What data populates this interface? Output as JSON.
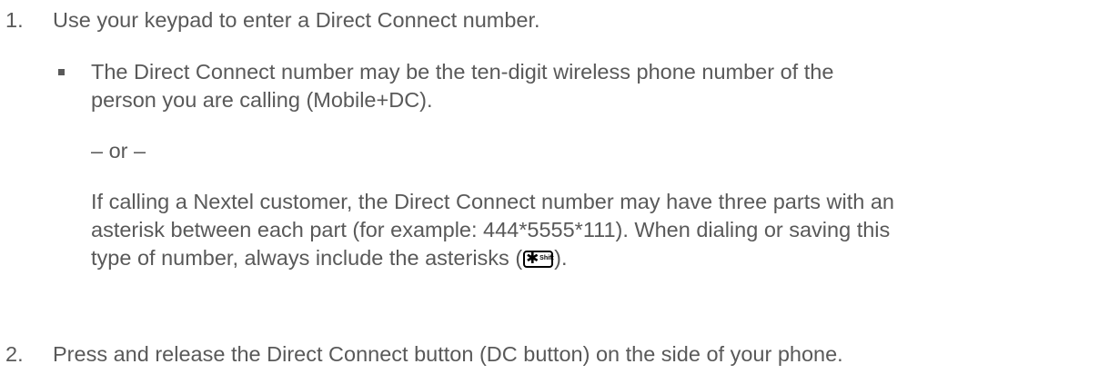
{
  "steps": [
    {
      "number": "1.",
      "text": "Use your keypad to enter a Direct Connect number."
    },
    {
      "number": "2.",
      "text": "Press and release the Direct Connect button (DC button) on the side of your phone."
    }
  ],
  "bullet": {
    "line1": "The Direct Connect number may be the ten-digit wireless phone number of the",
    "line2": "person you are calling (Mobile+DC)."
  },
  "separator": "– or –",
  "paragraph": {
    "line1": "If calling a Nextel customer, the Direct Connect number may have three parts with an",
    "line2": "asterisk between each part (for example: 444*5555*111). When dialing or saving this",
    "line3_before": "type of number, always include the asterisks (",
    "line3_after": ")."
  },
  "key_icon": {
    "glyph": "✱",
    "label": "Shift",
    "icon_name": "star-shift-key-icon"
  }
}
